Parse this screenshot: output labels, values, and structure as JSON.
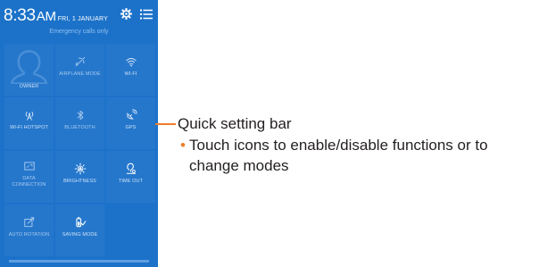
{
  "status_bar": {
    "time": "8:33",
    "ampm": "AM",
    "date": "FRI, 1 JANUARY",
    "settings_icon": "gear-icon",
    "menu_icon": "list-icon"
  },
  "emergency_text": "Emergency calls only",
  "tiles": [
    {
      "label": "OWNER",
      "icon": "user-icon"
    },
    {
      "label": "AIRPLANE MODE",
      "icon": "airplane-icon"
    },
    {
      "label": "WI-FI",
      "icon": "wifi-icon"
    },
    {
      "label": "WI-FI HOTSPOT",
      "icon": "hotspot-icon"
    },
    {
      "label": "BLUETOOTH",
      "icon": "bluetooth-icon"
    },
    {
      "label": "GPS",
      "icon": "gps-icon"
    },
    {
      "label_line1": "DATA",
      "label_line2": "CONNECTION",
      "icon": "data-connection-icon"
    },
    {
      "label": "BRIGHTNESS",
      "icon": "brightness-icon"
    },
    {
      "label": "TIME OUT",
      "icon": "timeout-icon"
    },
    {
      "label": "AUTO ROTATION",
      "icon": "rotation-icon"
    },
    {
      "label": "SAVING MODE",
      "icon": "battery-saving-icon"
    }
  ],
  "callout": {
    "title": "Quick setting bar",
    "bullet": "Touch icons to enable/disable functions or to change modes"
  },
  "colors": {
    "panel_background": "#1c72c9",
    "tile_background": "#2577cc",
    "callout_accent": "#ef7d2c"
  }
}
